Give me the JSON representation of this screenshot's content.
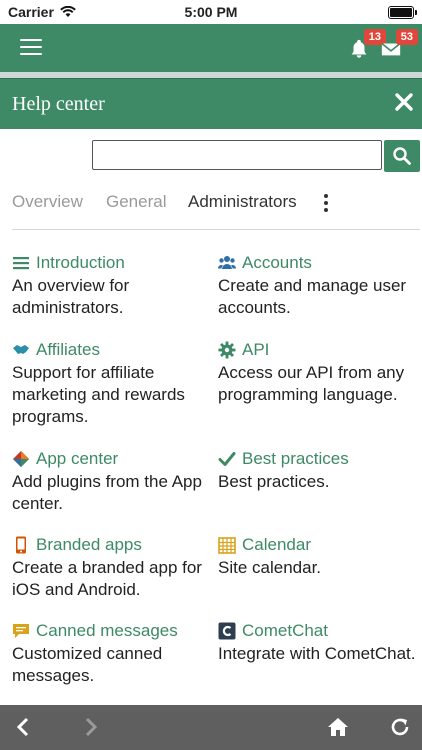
{
  "status_bar": {
    "carrier": "Carrier",
    "time": "5:00 PM"
  },
  "app_bar": {
    "notifications_count": "13",
    "messages_count": "53"
  },
  "panel": {
    "title": "Help center",
    "search": {
      "placeholder": "",
      "value": ""
    }
  },
  "tabs": [
    {
      "label": "Overview",
      "active": false
    },
    {
      "label": "General",
      "active": false
    },
    {
      "label": "Administrators",
      "active": true
    }
  ],
  "topics": [
    {
      "title": "Introduction",
      "description": "An overview for administrators.",
      "icon": "list-icon",
      "color": "#3e8a66"
    },
    {
      "title": "Accounts",
      "description": "Create and manage user accounts.",
      "icon": "users-icon",
      "color": "#2f6fa7"
    },
    {
      "title": "Affiliates",
      "description": "Support for affiliate marketing and rewards programs.",
      "icon": "handshake-icon",
      "color": "#2a8fa8"
    },
    {
      "title": "API",
      "description": "Access our API from any programming language.",
      "icon": "gear-icon",
      "color": "#3e8a66"
    },
    {
      "title": "App center",
      "description": "Add plugins from the App center.",
      "icon": "puzzle-icon",
      "color": "#c0392b"
    },
    {
      "title": "Best practices",
      "description": "Best practices.",
      "icon": "check-icon",
      "color": "#3e8a66"
    },
    {
      "title": "Branded apps",
      "description": "Create a branded app for iOS and Android.",
      "icon": "mobile-icon",
      "color": "#d35400"
    },
    {
      "title": "Calendar",
      "description": "Site calendar.",
      "icon": "calendar-icon",
      "color": "#d9a21b"
    },
    {
      "title": "Canned messages",
      "description": "Customized canned messages.",
      "icon": "chat-icon",
      "color": "#d9a21b"
    },
    {
      "title": "CometChat",
      "description": "Integrate with CometChat.",
      "icon": "cometchat-icon",
      "color": "#2c3e50"
    }
  ],
  "colors": {
    "accent": "#3e8a66",
    "badge": "#e0463a",
    "bottom_bar": "#5f5f5f"
  }
}
